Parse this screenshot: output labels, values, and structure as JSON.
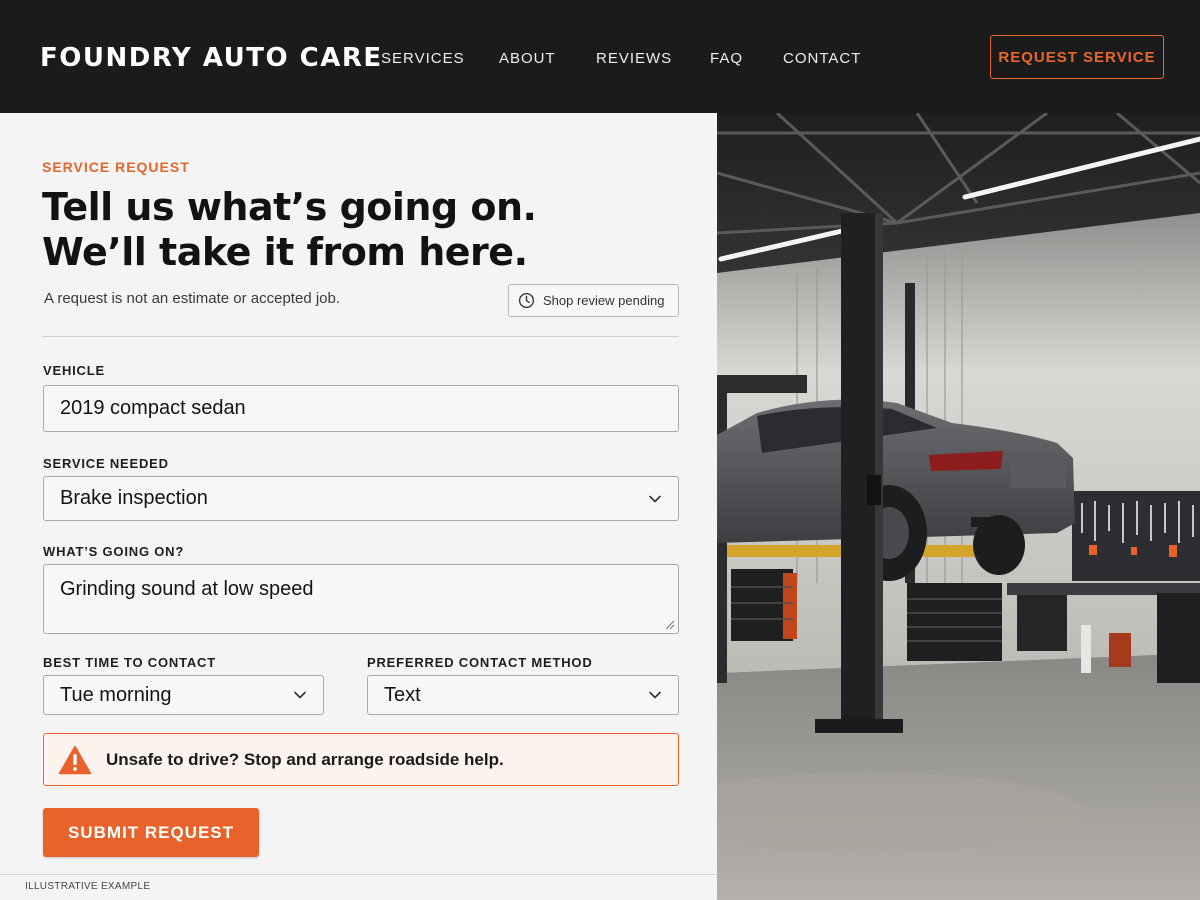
{
  "header": {
    "brand": "FOUNDRY AUTO CARE",
    "nav": [
      "SERVICES",
      "ABOUT",
      "REVIEWS",
      "FAQ",
      "CONTACT"
    ],
    "cta": "REQUEST SERVICE"
  },
  "form": {
    "eyebrow": "SERVICE REQUEST",
    "headline_line1": "Tell us what’s going on.",
    "headline_line2": "We’ll take it from here.",
    "subtext": "A request is not an estimate or accepted job.",
    "status_chip": "Shop review pending",
    "vehicle": {
      "label": "VEHICLE",
      "value": "2019 compact sedan"
    },
    "service": {
      "label": "SERVICE NEEDED",
      "value": "Brake inspection"
    },
    "issue": {
      "label": "WHAT’S GOING ON?",
      "value": "Grinding sound at low speed"
    },
    "contact_time": {
      "label": "BEST TIME TO CONTACT",
      "value": "Tue morning"
    },
    "contact_method": {
      "label": "PREFERRED CONTACT METHOD",
      "value": "Text"
    },
    "alert": "Unsafe to drive?  Stop and arrange roadside help.",
    "submit": "SUBMIT REQUEST",
    "footer_note": "ILLUSTRATIVE EXAMPLE"
  },
  "icons": {
    "status": "clock-icon",
    "alert": "warning-triangle-icon",
    "select": "chevron-down-icon"
  },
  "colors": {
    "accent": "#e8622a",
    "header_bg": "#1b1b1c",
    "panel_bg": "#f4f4f4"
  }
}
